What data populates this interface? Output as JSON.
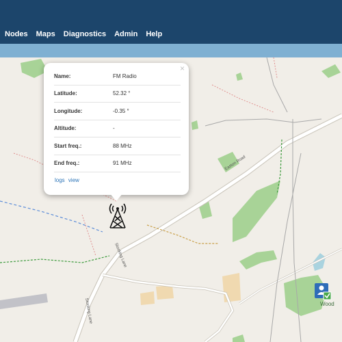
{
  "nav": {
    "items": [
      "Nodes",
      "Maps",
      "Diagnostics",
      "Admin",
      "Help"
    ]
  },
  "popup": {
    "close_label": "×",
    "rows": [
      {
        "label": "Name:",
        "value": "FM Radio"
      },
      {
        "label": "Latitude:",
        "value": "52.32 °"
      },
      {
        "label": "Longitude:",
        "value": "-0.35 °"
      },
      {
        "label": "Altitude:",
        "value": "-"
      },
      {
        "label": "Start freq.:",
        "value": "88 MHz"
      },
      {
        "label": "End freq.:",
        "value": "91 MHz"
      }
    ],
    "links": [
      "logs",
      "view"
    ]
  },
  "map": {
    "road_labels": [
      "Easton Road",
      "Stocking Lane",
      "Stocking Lane"
    ],
    "place_label": "Wood",
    "colors": {
      "background": "#f1eee8",
      "woodland": "#a8d397",
      "farmyard": "#f0d9b0",
      "road_outline": "#c8c3b8"
    }
  },
  "colors": {
    "topbar": "#1c456b",
    "subbar": "#7fb0d2",
    "link": "#2a73b7"
  }
}
